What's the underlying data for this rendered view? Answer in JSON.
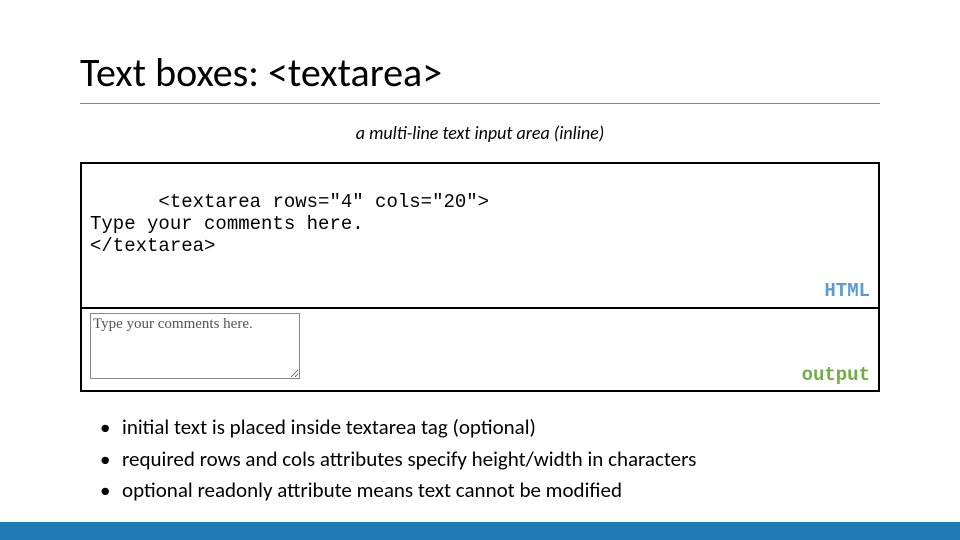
{
  "title": "Text boxes: <textarea>",
  "subtitle": "a multi-line text input area (inline)",
  "code": {
    "text": "<textarea rows=\"4\" cols=\"20\">\nType your comments here.\n</textarea>",
    "label": "HTML"
  },
  "output": {
    "textarea_content": "Type your comments here.",
    "label": "output"
  },
  "bullets": [
    "initial text is placed inside textarea tag (optional)",
    "required rows and cols attributes specify height/width in characters",
    "optional readonly attribute means text cannot be modified"
  ],
  "colors": {
    "html_label": "#5b9bd5",
    "output_label": "#70ad47",
    "footer": "#1f7ab5"
  }
}
